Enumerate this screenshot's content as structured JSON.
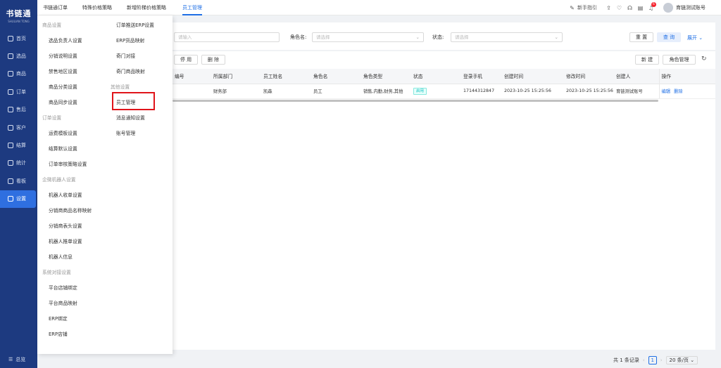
{
  "sidebar": {
    "logo_title": "书链通",
    "logo_sub": "SHULIAN TONG",
    "items": [
      {
        "label": "首页",
        "icon": "monitor-icon"
      },
      {
        "label": "选品",
        "icon": "box-icon"
      },
      {
        "label": "商品",
        "icon": "goods-icon"
      },
      {
        "label": "订单",
        "icon": "order-icon"
      },
      {
        "label": "售后",
        "icon": "service-icon"
      },
      {
        "label": "客户",
        "icon": "customer-icon"
      },
      {
        "label": "结算",
        "icon": "settle-icon"
      },
      {
        "label": "统计",
        "icon": "stats-icon"
      },
      {
        "label": "看板",
        "icon": "board-icon"
      },
      {
        "label": "设置",
        "icon": "settings-icon"
      }
    ],
    "footer": "总览"
  },
  "topbar": {
    "tabs": [
      "书链通订单",
      "特殊价格策略",
      "新增阶梯价格策略",
      "员工管理"
    ],
    "guide": "新手指引",
    "badge": "6",
    "user": "育链测试账号"
  },
  "filters": {
    "input_placeholder": "请输入",
    "role_label": "角色名:",
    "role_placeholder": "请选择",
    "status_label": "状态:",
    "status_placeholder": "请选择",
    "reset": "重 置",
    "query": "查 询",
    "expand": "展开"
  },
  "toolbar": {
    "disable": "停 用",
    "delete": "删 除",
    "new": "新 建",
    "role_mgmt": "角色管理"
  },
  "table": {
    "headers": [
      "编号",
      "所属部门",
      "员工姓名",
      "角色名",
      "角色类型",
      "状态",
      "登录手机",
      "创建时间",
      "修改时间",
      "创建人",
      "操作"
    ],
    "rows": [
      {
        "dept": "财务部",
        "name": "凯森",
        "role": "员工",
        "role_type": "销售,内勤,财务,其他",
        "status": "启用",
        "phone": "17144312847",
        "created": "2023-10-25 15:25:56",
        "modified": "2023-10-25 15:25:56",
        "creator": "育链测试账号",
        "edit": "编辑",
        "del": "删除"
      }
    ]
  },
  "pager": {
    "total": "共 1 条记录",
    "page": "1",
    "size": "20 条/页"
  },
  "menu": {
    "goods_group": "商品设置",
    "goods_items": [
      "选品负责人设置",
      "分销说明设置",
      "禁售地区设置",
      "商品分类设置",
      "商品同步设置"
    ],
    "col2_items": [
      "订单推送ERP设置",
      "ERP货品映射",
      "奇门对接",
      "奇门商品映射"
    ],
    "other_group": "其他设置",
    "other_items": [
      "员工管理",
      "消息通知设置",
      "账号管理"
    ],
    "order_group": "订单设置",
    "order_items": [
      "运费模板设置",
      "结算默认设置",
      "订单审核策略设置"
    ],
    "bot_group": "企微机器人设置",
    "bot_items": [
      "机器人收单设置",
      "分销商商品名称映射",
      "分销商表头设置",
      "机器人推单设置",
      "机器人信息"
    ],
    "sys_group": "系统对接设置",
    "sys_items": [
      "平台店铺绑定",
      "平台商品映射",
      "ERP绑定",
      "ERP店铺"
    ]
  }
}
